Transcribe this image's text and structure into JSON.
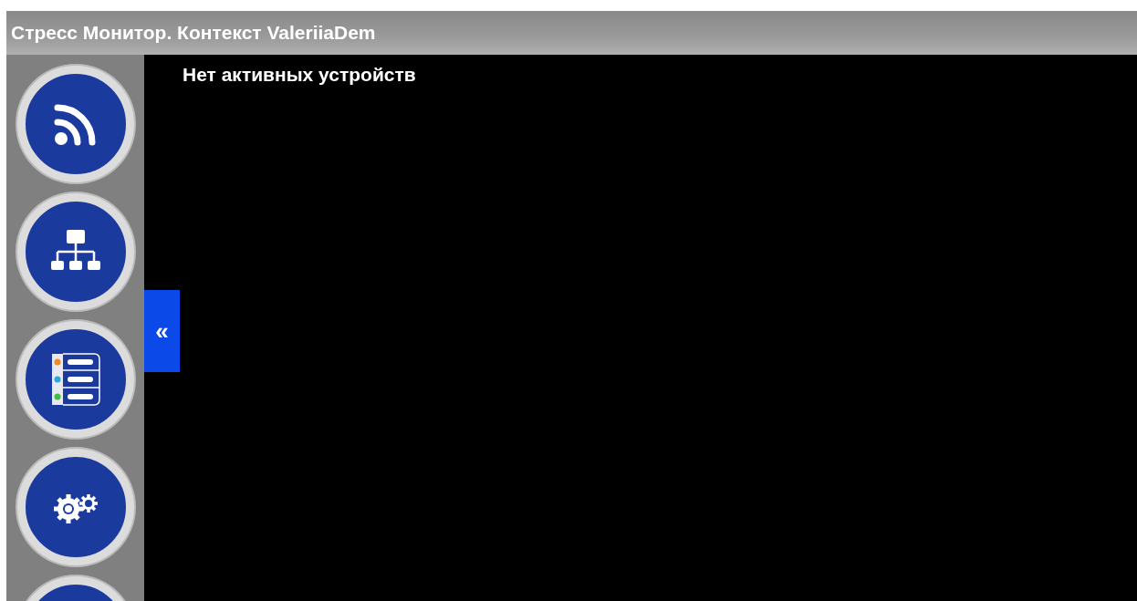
{
  "window": {
    "title": "Стресс Монитор. Контекст ValeriiaDem"
  },
  "collapse_tab": {
    "label": "«"
  },
  "main": {
    "message": "Нет активных устройств"
  }
}
